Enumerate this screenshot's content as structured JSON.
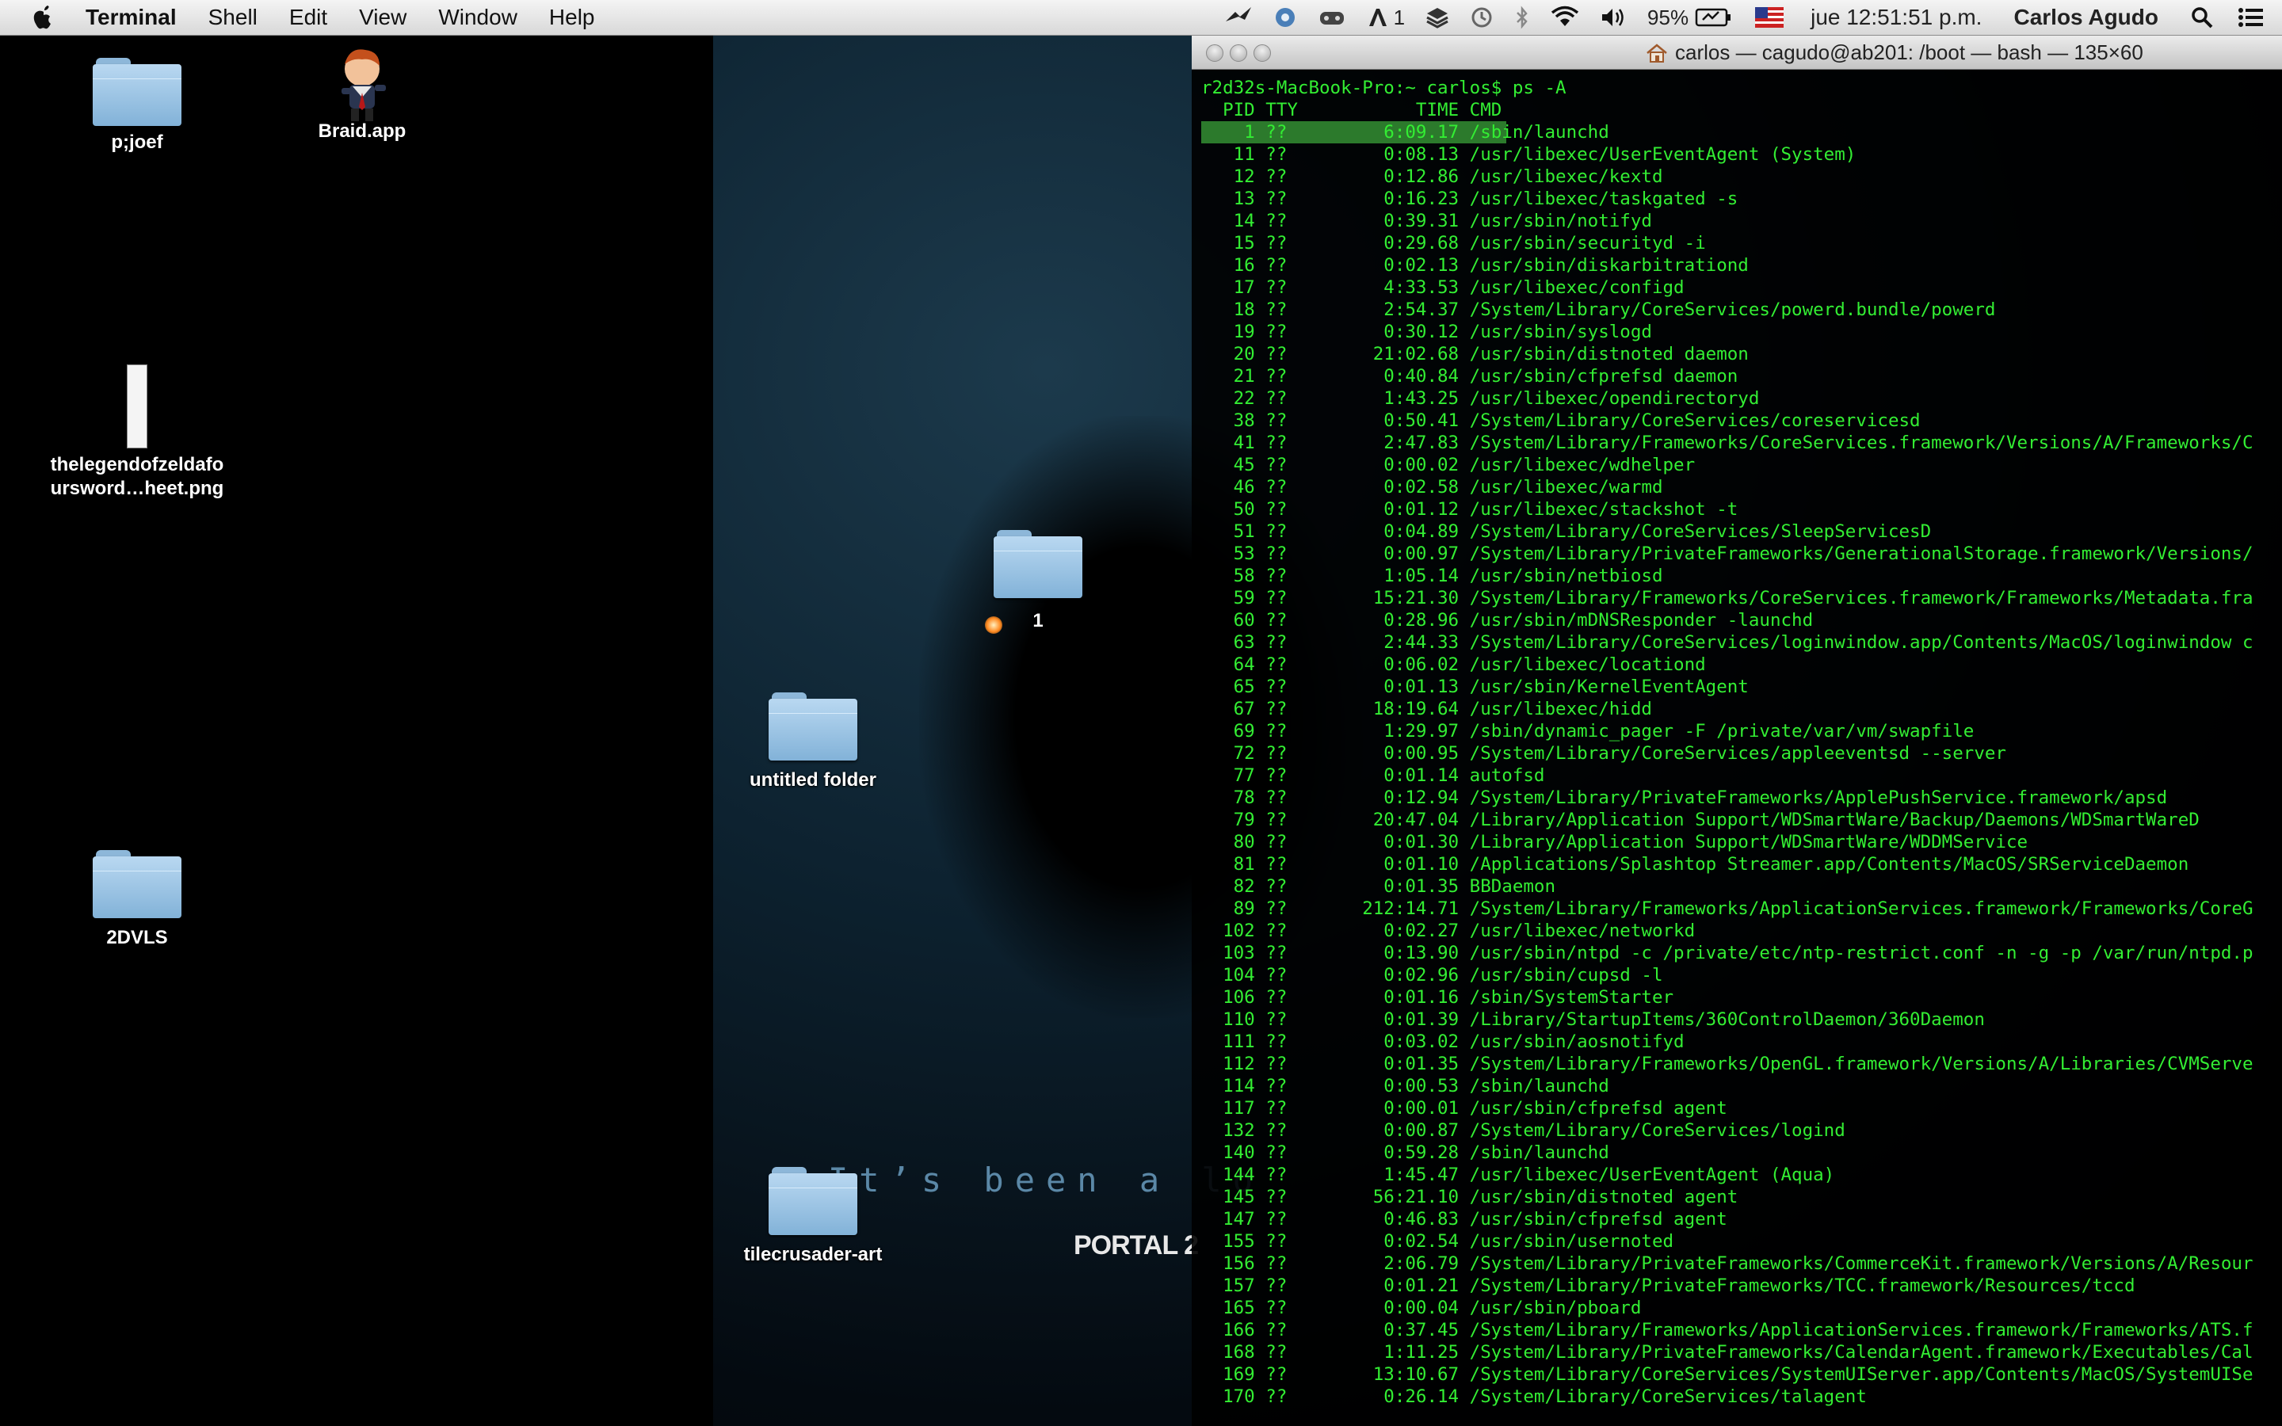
{
  "menubar": {
    "app": "Terminal",
    "menus": [
      "Shell",
      "Edit",
      "View",
      "Window",
      "Help"
    ],
    "status": {
      "spaces": "1",
      "battery": "95%",
      "clock": "jue 12:51:51 p.m.",
      "user": "Carlos Agudo"
    }
  },
  "desktop": {
    "icons": {
      "pjoef": "p;joef",
      "braid": "Braid.app",
      "zelda": "thelegendofzeldafo ursword…heet.png",
      "one": "1",
      "untitled": "untitled folder",
      "twodvls": "2DVLS",
      "tilecrusader": "tilecrusader-art"
    },
    "wallpaper": {
      "tagline": "It’s been a lo",
      "logo": "PORTAL 2"
    }
  },
  "terminal": {
    "title": "carlos — cagudo@ab201: /boot — bash — 135×60",
    "prompt": "r2d32s-MacBook-Pro:~ carlos$ ps -A",
    "header": "  PID TTY           TIME CMD",
    "lines": [
      "    1 ??         6:09.17 /sbin/launchd",
      "   11 ??         0:08.13 /usr/libexec/UserEventAgent (System)",
      "   12 ??         0:12.86 /usr/libexec/kextd",
      "   13 ??         0:16.23 /usr/libexec/taskgated -s",
      "   14 ??         0:39.31 /usr/sbin/notifyd",
      "   15 ??         0:29.68 /usr/sbin/securityd -i",
      "   16 ??         0:02.13 /usr/sbin/diskarbitrationd",
      "   17 ??         4:33.53 /usr/libexec/configd",
      "   18 ??         2:54.37 /System/Library/CoreServices/powerd.bundle/powerd",
      "   19 ??         0:30.12 /usr/sbin/syslogd",
      "   20 ??        21:02.68 /usr/sbin/distnoted daemon",
      "   21 ??         0:40.84 /usr/sbin/cfprefsd daemon",
      "   22 ??         1:43.25 /usr/libexec/opendirectoryd",
      "   38 ??         0:50.41 /System/Library/CoreServices/coreservicesd",
      "   41 ??         2:47.83 /System/Library/Frameworks/CoreServices.framework/Versions/A/Frameworks/C",
      "   45 ??         0:00.02 /usr/libexec/wdhelper",
      "   46 ??         0:02.58 /usr/libexec/warmd",
      "   50 ??         0:01.12 /usr/libexec/stackshot -t",
      "   51 ??         0:04.89 /System/Library/CoreServices/SleepServicesD",
      "   53 ??         0:00.97 /System/Library/PrivateFrameworks/GenerationalStorage.framework/Versions/",
      "   58 ??         1:05.14 /usr/sbin/netbiosd",
      "   59 ??        15:21.30 /System/Library/Frameworks/CoreServices.framework/Frameworks/Metadata.fra",
      "   60 ??         0:28.96 /usr/sbin/mDNSResponder -launchd",
      "   63 ??         2:44.33 /System/Library/CoreServices/loginwindow.app/Contents/MacOS/loginwindow c",
      "   64 ??         0:06.02 /usr/libexec/locationd",
      "   65 ??         0:01.13 /usr/sbin/KernelEventAgent",
      "   67 ??        18:19.64 /usr/libexec/hidd",
      "   69 ??         1:29.97 /sbin/dynamic_pager -F /private/var/vm/swapfile",
      "   72 ??         0:00.95 /System/Library/CoreServices/appleeventsd --server",
      "   77 ??         0:01.14 autofsd",
      "   78 ??         0:12.94 /System/Library/PrivateFrameworks/ApplePushService.framework/apsd",
      "   79 ??        20:47.04 /Library/Application Support/WDSmartWare/Backup/Daemons/WDSmartWareD",
      "   80 ??         0:01.30 /Library/Application Support/WDSmartWare/WDDMService",
      "   81 ??         0:01.10 /Applications/Splashtop Streamer.app/Contents/MacOS/SRServiceDaemon",
      "   82 ??         0:01.35 BBDaemon",
      "   89 ??       212:14.71 /System/Library/Frameworks/ApplicationServices.framework/Frameworks/CoreG",
      "  102 ??         0:02.27 /usr/libexec/networkd",
      "  103 ??         0:13.90 /usr/sbin/ntpd -c /private/etc/ntp-restrict.conf -n -g -p /var/run/ntpd.p",
      "  104 ??         0:02.96 /usr/sbin/cupsd -l",
      "  106 ??         0:01.16 /sbin/SystemStarter",
      "  110 ??         0:01.39 /Library/StartupItems/360ControlDaemon/360Daemon",
      "  111 ??         0:03.02 /usr/sbin/aosnotifyd",
      "  112 ??         0:01.35 /System/Library/Frameworks/OpenGL.framework/Versions/A/Libraries/CVMServe",
      "  114 ??         0:00.53 /sbin/launchd",
      "  117 ??         0:00.01 /usr/sbin/cfprefsd agent",
      "  132 ??         0:00.87 /System/Library/CoreServices/logind",
      "  140 ??         0:59.28 /sbin/launchd",
      "  144 ??         1:45.47 /usr/libexec/UserEventAgent (Aqua)",
      "  145 ??        56:21.10 /usr/sbin/distnoted agent",
      "  147 ??         0:46.83 /usr/sbin/cfprefsd agent",
      "  155 ??         0:02.54 /usr/sbin/usernoted",
      "  156 ??         2:06.79 /System/Library/PrivateFrameworks/CommerceKit.framework/Versions/A/Resour",
      "  157 ??         0:01.21 /System/Library/PrivateFrameworks/TCC.framework/Resources/tccd",
      "  165 ??         0:00.04 /usr/sbin/pboard",
      "  166 ??         0:37.45 /System/Library/Frameworks/ApplicationServices.framework/Frameworks/ATS.f",
      "  168 ??         1:11.25 /System/Library/PrivateFrameworks/CalendarAgent.framework/Executables/Cal",
      "  169 ??        13:10.67 /System/Library/CoreServices/SystemUIServer.app/Contents/MacOS/SystemUISe",
      "  170 ??         0:26.14 /System/Library/CoreServices/talagent"
    ]
  }
}
